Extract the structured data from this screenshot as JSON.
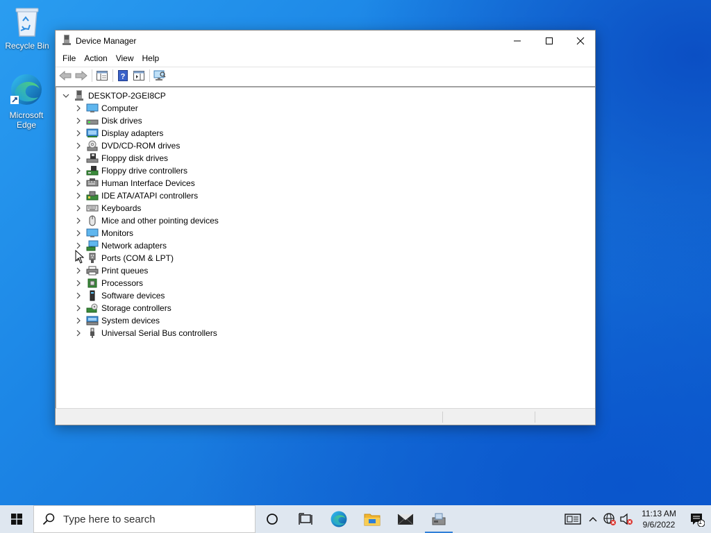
{
  "desktop": {
    "icons": [
      {
        "label": "Recycle Bin"
      },
      {
        "label": "Microsoft Edge"
      }
    ]
  },
  "window": {
    "title": "Device Manager",
    "menu": [
      "File",
      "Action",
      "View",
      "Help"
    ],
    "root_node": "DESKTOP-2GEI8CP",
    "devices": [
      {
        "label": "Computer",
        "icon": "computer-icon"
      },
      {
        "label": "Disk drives",
        "icon": "disk-drive-icon"
      },
      {
        "label": "Display adapters",
        "icon": "display-adapter-icon"
      },
      {
        "label": "DVD/CD-ROM drives",
        "icon": "dvd-drive-icon"
      },
      {
        "label": "Floppy disk drives",
        "icon": "floppy-disk-icon"
      },
      {
        "label": "Floppy drive controllers",
        "icon": "floppy-controller-icon"
      },
      {
        "label": "Human Interface Devices",
        "icon": "hid-icon"
      },
      {
        "label": "IDE ATA/ATAPI controllers",
        "icon": "ide-controller-icon"
      },
      {
        "label": "Keyboards",
        "icon": "keyboard-icon"
      },
      {
        "label": "Mice and other pointing devices",
        "icon": "mouse-icon"
      },
      {
        "label": "Monitors",
        "icon": "monitor-icon"
      },
      {
        "label": "Network adapters",
        "icon": "network-adapter-icon"
      },
      {
        "label": "Ports (COM & LPT)",
        "icon": "port-icon"
      },
      {
        "label": "Print queues",
        "icon": "printer-icon"
      },
      {
        "label": "Processors",
        "icon": "processor-icon"
      },
      {
        "label": "Software devices",
        "icon": "software-device-icon"
      },
      {
        "label": "Storage controllers",
        "icon": "storage-controller-icon"
      },
      {
        "label": "System devices",
        "icon": "system-device-icon"
      },
      {
        "label": "Universal Serial Bus controllers",
        "icon": "usb-icon"
      }
    ]
  },
  "taskbar": {
    "search_placeholder": "Type here to search",
    "clock_time": "11:13 AM",
    "clock_date": "9/6/2022",
    "notification_count": "1"
  },
  "colors": {
    "accent": "#2f7fd8",
    "desktop_blue": "#1a6fd6",
    "taskbar_bg": "#dfe7f0"
  }
}
